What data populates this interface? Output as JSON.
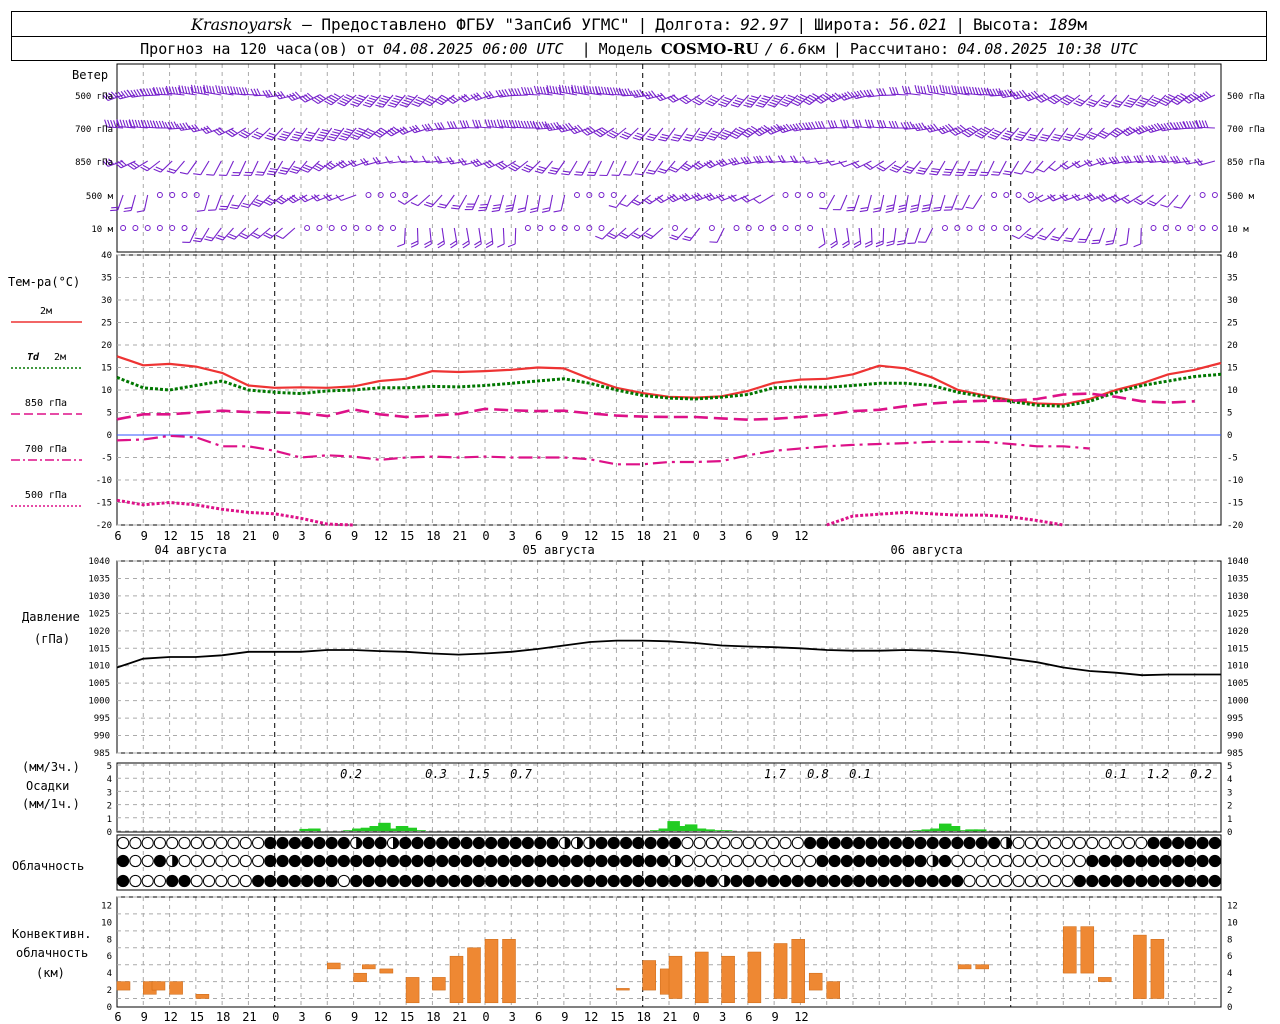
{
  "header": {
    "city": "Krasnoyarsk",
    "dash": " — ",
    "provider": "Предоставлено ФГБУ \"ЗапСиб УГМС\"",
    "sep": "|",
    "lon_label": "Долгота:",
    "lon_value": "92.97",
    "lat_label": "Широта:",
    "lat_value": "56.021",
    "alt_label": "Высота:",
    "alt_value": "189",
    "alt_unit": "м",
    "forecast_label": "Прогноз на 120 часа(ов) от",
    "forecast_start": "04.08.2025 06:00 UTC",
    "model_label": "Модель",
    "model_name": "COSMO-RU",
    "model_res": "6.6",
    "model_res_unit": "км",
    "computed_label": "Рассчитано:",
    "computed_value": "04.08.2025 10:38 UTC"
  },
  "colors": {
    "t2m": "#ee3333",
    "td2m": "#007700",
    "t850": "#dd1188",
    "t700": "#dd1188",
    "t500": "#dd1188",
    "wind": "#7722cc",
    "precip": "#22cc22",
    "convective": "#ee8833",
    "pressure": "#000000",
    "zeroline": "#3355ff"
  },
  "x_axis": {
    "tick_hours": [
      "6",
      "9",
      "12",
      "15",
      "18",
      "21",
      "0",
      "3",
      "6",
      "9",
      "12",
      "15",
      "18",
      "21",
      "0",
      "3",
      "6",
      "9",
      "12",
      "15",
      "18",
      "21",
      "0",
      "3",
      "6",
      "9",
      "12"
    ],
    "dates": [
      "04 августа",
      "05 августа",
      "06 августа"
    ]
  },
  "wind_panel": {
    "title": "Ветер",
    "levels": [
      "500 гПа",
      "700 гПа",
      "850 гПа",
      "500 м",
      "10 м"
    ]
  },
  "temp_panel": {
    "title": "Тем-ра(°C)",
    "yticks": [
      "40",
      "35",
      "30",
      "25",
      "20",
      "15",
      "10",
      "5",
      "0",
      "-5",
      "-10",
      "-15",
      "-20"
    ],
    "legend": [
      {
        "label": "2м",
        "italic_prefix": ""
      },
      {
        "label": "2м",
        "italic_prefix": "Td"
      },
      {
        "label": "850 гПа",
        "italic_prefix": ""
      },
      {
        "label": "700 гПа",
        "italic_prefix": ""
      },
      {
        "label": "500 гПа",
        "italic_prefix": ""
      }
    ]
  },
  "pressure_panel": {
    "title": "Давление",
    "unit": "(гПа)",
    "yticks": [
      "1040",
      "1035",
      "1030",
      "1025",
      "1020",
      "1015",
      "1010",
      "1005",
      "1000",
      "995",
      "990",
      "985"
    ]
  },
  "precip_panel": {
    "unit_3h": "(мм/3ч.)",
    "title": "Осадки",
    "unit_1h": "(мм/1ч.)",
    "yticks": [
      "5",
      "4",
      "3",
      "2",
      "1",
      "0",
      "4",
      "3",
      "2",
      "1",
      "0"
    ],
    "labels": [
      "0.2",
      "0.3",
      "1.5",
      "0.7",
      "1.7",
      "0.8",
      "0.1",
      "0.1",
      "1.2",
      "0.2"
    ]
  },
  "cloud_panel": {
    "title": "Облачность"
  },
  "conv_panel": {
    "title1": "Конвективн.",
    "title2": "облачность",
    "unit": "(км)",
    "yticks": [
      "12",
      "10",
      "8",
      "6",
      "4",
      "2",
      "0"
    ]
  },
  "chart_data": [
    {
      "type": "line",
      "title": "Тем-ра(°C)",
      "x_hours": [
        0,
        3,
        6,
        9,
        12,
        15,
        18,
        21,
        24,
        27,
        30,
        33,
        36,
        39,
        42,
        45,
        48,
        51,
        54,
        57,
        60,
        63,
        66,
        69,
        72,
        75,
        78,
        81,
        84,
        87,
        90,
        93,
        96,
        99,
        102,
        105,
        108,
        111,
        114,
        117,
        120,
        123,
        126
      ],
      "ylim": [
        -20,
        40
      ],
      "series": [
        {
          "name": "2м",
          "values": [
            17.5,
            15.5,
            15.8,
            15.2,
            13.8,
            11.0,
            10.5,
            10.6,
            10.5,
            10.8,
            12.0,
            12.5,
            14.2,
            14.0,
            14.2,
            14.5,
            15.0,
            14.8,
            12.5,
            10.5,
            9.3,
            8.5,
            8.3,
            8.6,
            9.8,
            11.6,
            12.3,
            12.5,
            13.5,
            15.4,
            14.8,
            12.8,
            10.0,
            8.8,
            7.8,
            7.0,
            6.8,
            8.0,
            10.0,
            11.5,
            13.5,
            14.5,
            16.0
          ]
        },
        {
          "name": "Td 2м",
          "values": [
            12.8,
            10.5,
            10.0,
            11.0,
            12.0,
            10.0,
            9.5,
            9.2,
            9.8,
            10.0,
            10.5,
            10.5,
            10.8,
            10.7,
            11.0,
            11.5,
            12.0,
            12.5,
            11.5,
            10.0,
            8.8,
            8.2,
            8.0,
            8.4,
            9.0,
            10.5,
            10.7,
            10.6,
            11.0,
            11.5,
            11.5,
            11.0,
            9.5,
            8.5,
            7.5,
            6.6,
            6.4,
            7.5,
            9.5,
            11.0,
            12.0,
            13.0,
            13.5
          ]
        },
        {
          "name": "850 гПа",
          "values": [
            3.5,
            4.6,
            4.6,
            5.0,
            5.4,
            5.1,
            5.0,
            4.9,
            4.2,
            5.7,
            4.6,
            4.0,
            4.3,
            4.7,
            5.8,
            5.5,
            5.3,
            5.4,
            4.8,
            4.3,
            4.1,
            4.0,
            4.0,
            3.7,
            3.4,
            3.6,
            4.0,
            4.5,
            5.3,
            5.6,
            6.4,
            7.0,
            7.4,
            7.6,
            7.6,
            8.0,
            9.0,
            9.2,
            8.5,
            7.5,
            7.2,
            7.5
          ]
        },
        {
          "name": "700 гПа",
          "values": [
            -1.2,
            -1.0,
            -0.2,
            -0.5,
            -2.5,
            -2.5,
            -3.5,
            -5.0,
            -4.5,
            -4.8,
            -5.5,
            -5.0,
            -4.8,
            -5.0,
            -4.8,
            -5.0,
            -5.0,
            -5.0,
            -5.4,
            -6.5,
            -6.5,
            -6.0,
            -6.0,
            -5.8,
            -4.5,
            -3.5,
            -3.0,
            -2.5,
            -2.2,
            -2.0,
            -1.8,
            -1.5,
            -1.5,
            -1.5,
            -2.0,
            -2.5,
            -2.5,
            -3.0
          ]
        },
        {
          "name": "500 гПа",
          "values": [
            -14.5,
            -15.5,
            -15.0,
            -15.5,
            -16.5,
            -17.2,
            -17.5,
            -18.5,
            -19.8,
            -20.0,
            null,
            null,
            null,
            null,
            null,
            null,
            null,
            null,
            null,
            null,
            null,
            null,
            null,
            null,
            null,
            null,
            null,
            -20.0,
            -18.0,
            -17.6,
            -17.2,
            -17.5,
            -17.8,
            -17.8,
            -18.2,
            -19.0,
            -20.0
          ]
        }
      ]
    },
    {
      "type": "line",
      "title": "Давление",
      "ylim": [
        985,
        1040
      ],
      "x_hours": [
        0,
        3,
        6,
        9,
        12,
        15,
        18,
        21,
        24,
        27,
        30,
        33,
        36,
        39,
        42,
        45,
        48,
        51,
        54,
        57,
        60,
        63,
        66,
        69,
        72,
        75,
        78,
        81,
        84,
        87,
        90,
        93,
        96,
        99,
        102,
        105,
        108,
        111,
        114,
        117,
        120,
        123,
        126
      ],
      "series": [
        {
          "name": "",
          "values": [
            1009.5,
            1012,
            1012.5,
            1012.5,
            1013,
            1014,
            1014,
            1014,
            1014.5,
            1014.5,
            1014.2,
            1014,
            1013.5,
            1013.2,
            1013.5,
            1014,
            1014.8,
            1015.8,
            1016.8,
            1017.2,
            1017.2,
            1017.0,
            1016.5,
            1015.8,
            1015.5,
            1015.3,
            1015.0,
            1014.5,
            1014.3,
            1014.3,
            1014.5,
            1014.3,
            1013.8,
            1013.0,
            1012.0,
            1011.0,
            1009.5,
            1008.5,
            1008.0,
            1007.3,
            1007.5,
            1007.5,
            1007.5
          ]
        }
      ]
    },
    {
      "type": "bar",
      "title": "Осадки",
      "x_hours_center": [
        21.5,
        22.5,
        26.5,
        27.5,
        28.5,
        29.5,
        30.5,
        31.5,
        32.5,
        33.5,
        34.5,
        61.5,
        62.5,
        63.5,
        64.5,
        65.5,
        66.5,
        67.5,
        68.5,
        69.5,
        91.5,
        92.5,
        93.5,
        94.5,
        95.5,
        96.5,
        97.5,
        98.5
      ],
      "values_mm_1h": [
        0.25,
        0.3,
        0.1,
        0.3,
        0.4,
        0.6,
        1.0,
        0.3,
        0.6,
        0.4,
        0.1,
        0.1,
        0.3,
        1.2,
        0.6,
        0.8,
        0.3,
        0.2,
        0.1,
        0.1,
        0.1,
        0.2,
        0.3,
        0.9,
        0.6,
        0.1,
        0.2,
        0.2
      ]
    },
    {
      "type": "bar",
      "title": "Конвективн. облачность",
      "ylim": [
        0,
        13
      ],
      "bars_km": [
        {
          "h": 0,
          "base": 2.0,
          "top": 3.0
        },
        {
          "h": 3,
          "base": 1.5,
          "top": 3.0
        },
        {
          "h": 4,
          "base": 2.0,
          "top": 3.0
        },
        {
          "h": 6,
          "base": 1.5,
          "top": 3.0
        },
        {
          "h": 9,
          "base": 1.0,
          "top": 1.5
        },
        {
          "h": 24,
          "base": 4.5,
          "top": 5.2
        },
        {
          "h": 27,
          "base": 3.0,
          "top": 4.0
        },
        {
          "h": 28,
          "base": 4.5,
          "top": 5.0
        },
        {
          "h": 30,
          "base": 4.0,
          "top": 4.5
        },
        {
          "h": 33,
          "base": 0.5,
          "top": 3.5
        },
        {
          "h": 36,
          "base": 2.0,
          "top": 3.5
        },
        {
          "h": 38,
          "base": 0.5,
          "top": 6.0
        },
        {
          "h": 40,
          "base": 0.5,
          "top": 7.0
        },
        {
          "h": 42,
          "base": 0.5,
          "top": 8.0
        },
        {
          "h": 44,
          "base": 0.5,
          "top": 8.0
        },
        {
          "h": 57,
          "base": 2.0,
          "top": 2.2
        },
        {
          "h": 60,
          "base": 2.0,
          "top": 5.5
        },
        {
          "h": 62,
          "base": 1.5,
          "top": 4.5
        },
        {
          "h": 63,
          "base": 1.0,
          "top": 6.0
        },
        {
          "h": 66,
          "base": 0.5,
          "top": 6.5
        },
        {
          "h": 69,
          "base": 0.5,
          "top": 6.0
        },
        {
          "h": 72,
          "base": 0.5,
          "top": 6.5
        },
        {
          "h": 75,
          "base": 1.0,
          "top": 7.5
        },
        {
          "h": 77,
          "base": 0.5,
          "top": 8.0
        },
        {
          "h": 79,
          "base": 2.0,
          "top": 4.0
        },
        {
          "h": 81,
          "base": 1.0,
          "top": 3.0
        },
        {
          "h": 96,
          "base": 4.5,
          "top": 5.0
        },
        {
          "h": 98,
          "base": 4.5,
          "top": 5.0
        },
        {
          "h": 108,
          "base": 4.0,
          "top": 9.5
        },
        {
          "h": 110,
          "base": 4.0,
          "top": 9.5
        },
        {
          "h": 112,
          "base": 3.0,
          "top": 3.5
        },
        {
          "h": 116,
          "base": 1.0,
          "top": 8.5
        },
        {
          "h": 118,
          "base": 1.0,
          "top": 8.0
        }
      ]
    }
  ]
}
